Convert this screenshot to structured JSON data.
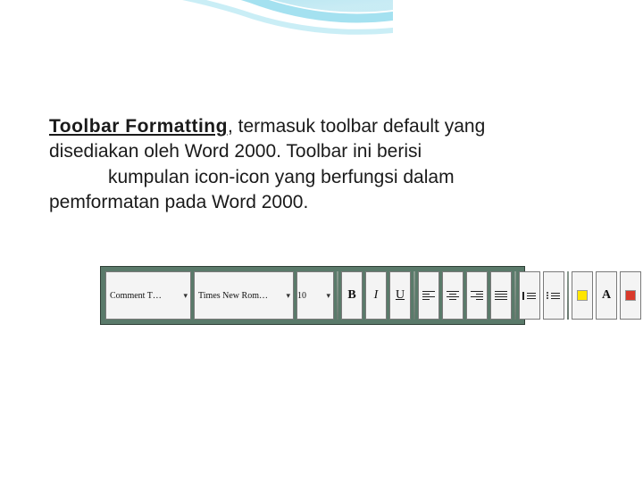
{
  "heading": "Toolbar  Formatting",
  "para1_after": ",  termasuk  toolbar  default  yang",
  "para2": "disediakan  oleh  Word 2000. Toolbar ini berisi",
  "para3": "kumpulan icon-icon yang berfungsi dalam",
  "para4": "pemformatan pada Word 2000.",
  "toolbar": {
    "style": "Comment T…",
    "font": "Times New Rom…",
    "size": "10",
    "bold": "B",
    "italic": "I",
    "underline": "U",
    "fontA": "A"
  }
}
